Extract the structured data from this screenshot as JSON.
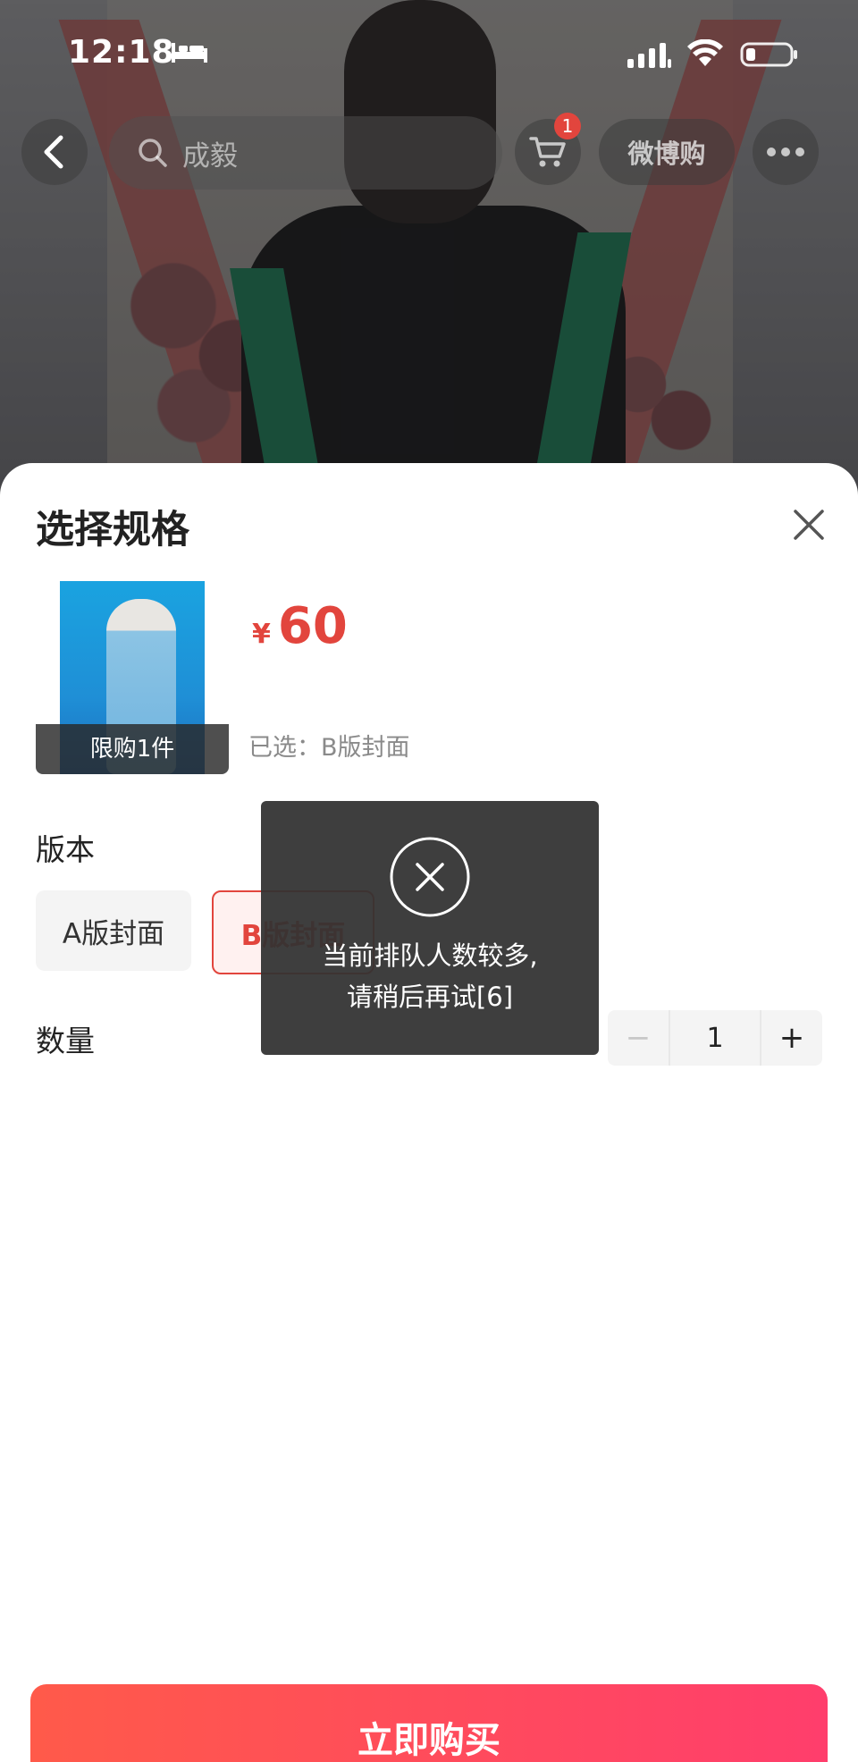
{
  "status_bar": {
    "time": "12:18"
  },
  "nav": {
    "search_text": "成毅",
    "cart_count": "1",
    "weibo_label": "微博购"
  },
  "sheet": {
    "title": "选择规格",
    "product": {
      "limit_label": "限购1件",
      "currency": "¥",
      "price": "60",
      "selected_prefix": "已选：",
      "selected_value": "B版封面"
    },
    "version": {
      "label": "版本",
      "options": [
        "A版封面",
        "B版封面"
      ],
      "selected": "B版封面"
    },
    "quantity": {
      "label": "数量",
      "value": "1",
      "minus": "−",
      "plus": "+"
    },
    "buy_label": "立即购买"
  },
  "toast": {
    "line1": "当前排队人数较多,",
    "line2": "请稍后再试[6]"
  },
  "colors": {
    "accent": "#e2453d",
    "buy_gradient_start": "#ff5a4a",
    "buy_gradient_end": "#ff3e6c"
  }
}
